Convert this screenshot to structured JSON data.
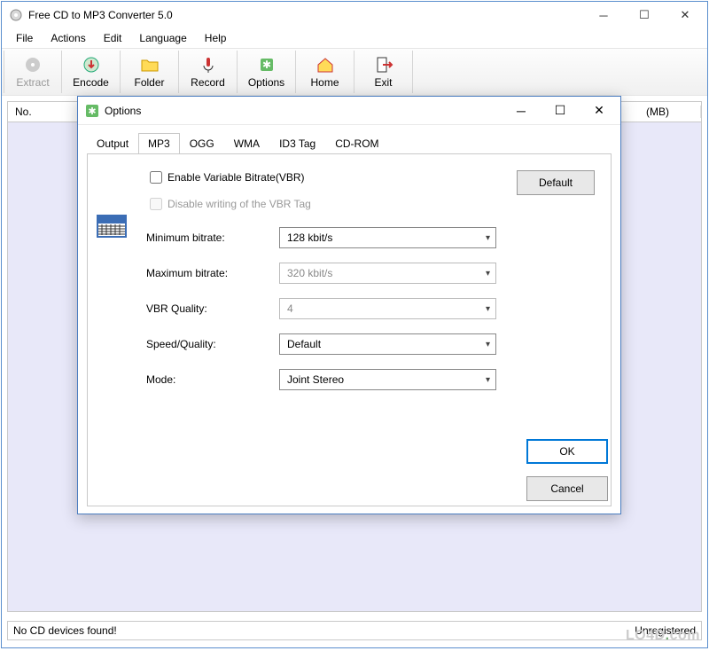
{
  "mainWindow": {
    "title": "Free CD to MP3 Converter 5.0",
    "menus": {
      "file": "File",
      "actions": "Actions",
      "edit": "Edit",
      "language": "Language",
      "help": "Help"
    },
    "toolbar": {
      "extract": "Extract",
      "encode": "Encode",
      "folder": "Folder",
      "record": "Record",
      "options": "Options",
      "home": "Home",
      "exit": "Exit"
    },
    "table": {
      "no": "No.",
      "mb": "(MB)"
    },
    "status": "No CD devices found!",
    "registration": "Unregistered"
  },
  "dialog": {
    "title": "Options",
    "tabs": {
      "output": "Output",
      "mp3": "MP3",
      "ogg": "OGG",
      "wma": "WMA",
      "id3": "ID3 Tag",
      "cdrom": "CD-ROM"
    },
    "vbrEnable": "Enable Variable Bitrate(VBR)",
    "vbrDisableTag": "Disable writing of the VBR Tag",
    "defaultBtn": "Default",
    "labels": {
      "minBitrate": "Minimum bitrate:",
      "maxBitrate": "Maximum bitrate:",
      "vbrQuality": "VBR Quality:",
      "speedQuality": "Speed/Quality:",
      "mode": "Mode:"
    },
    "values": {
      "minBitrate": "128 kbit/s",
      "maxBitrate": "320 kbit/s",
      "vbrQuality": "4",
      "speedQuality": "Default",
      "mode": "Joint Stereo"
    },
    "ok": "OK",
    "cancel": "Cancel"
  },
  "watermark": {
    "part1": "LO4D",
    "part2": "com"
  }
}
